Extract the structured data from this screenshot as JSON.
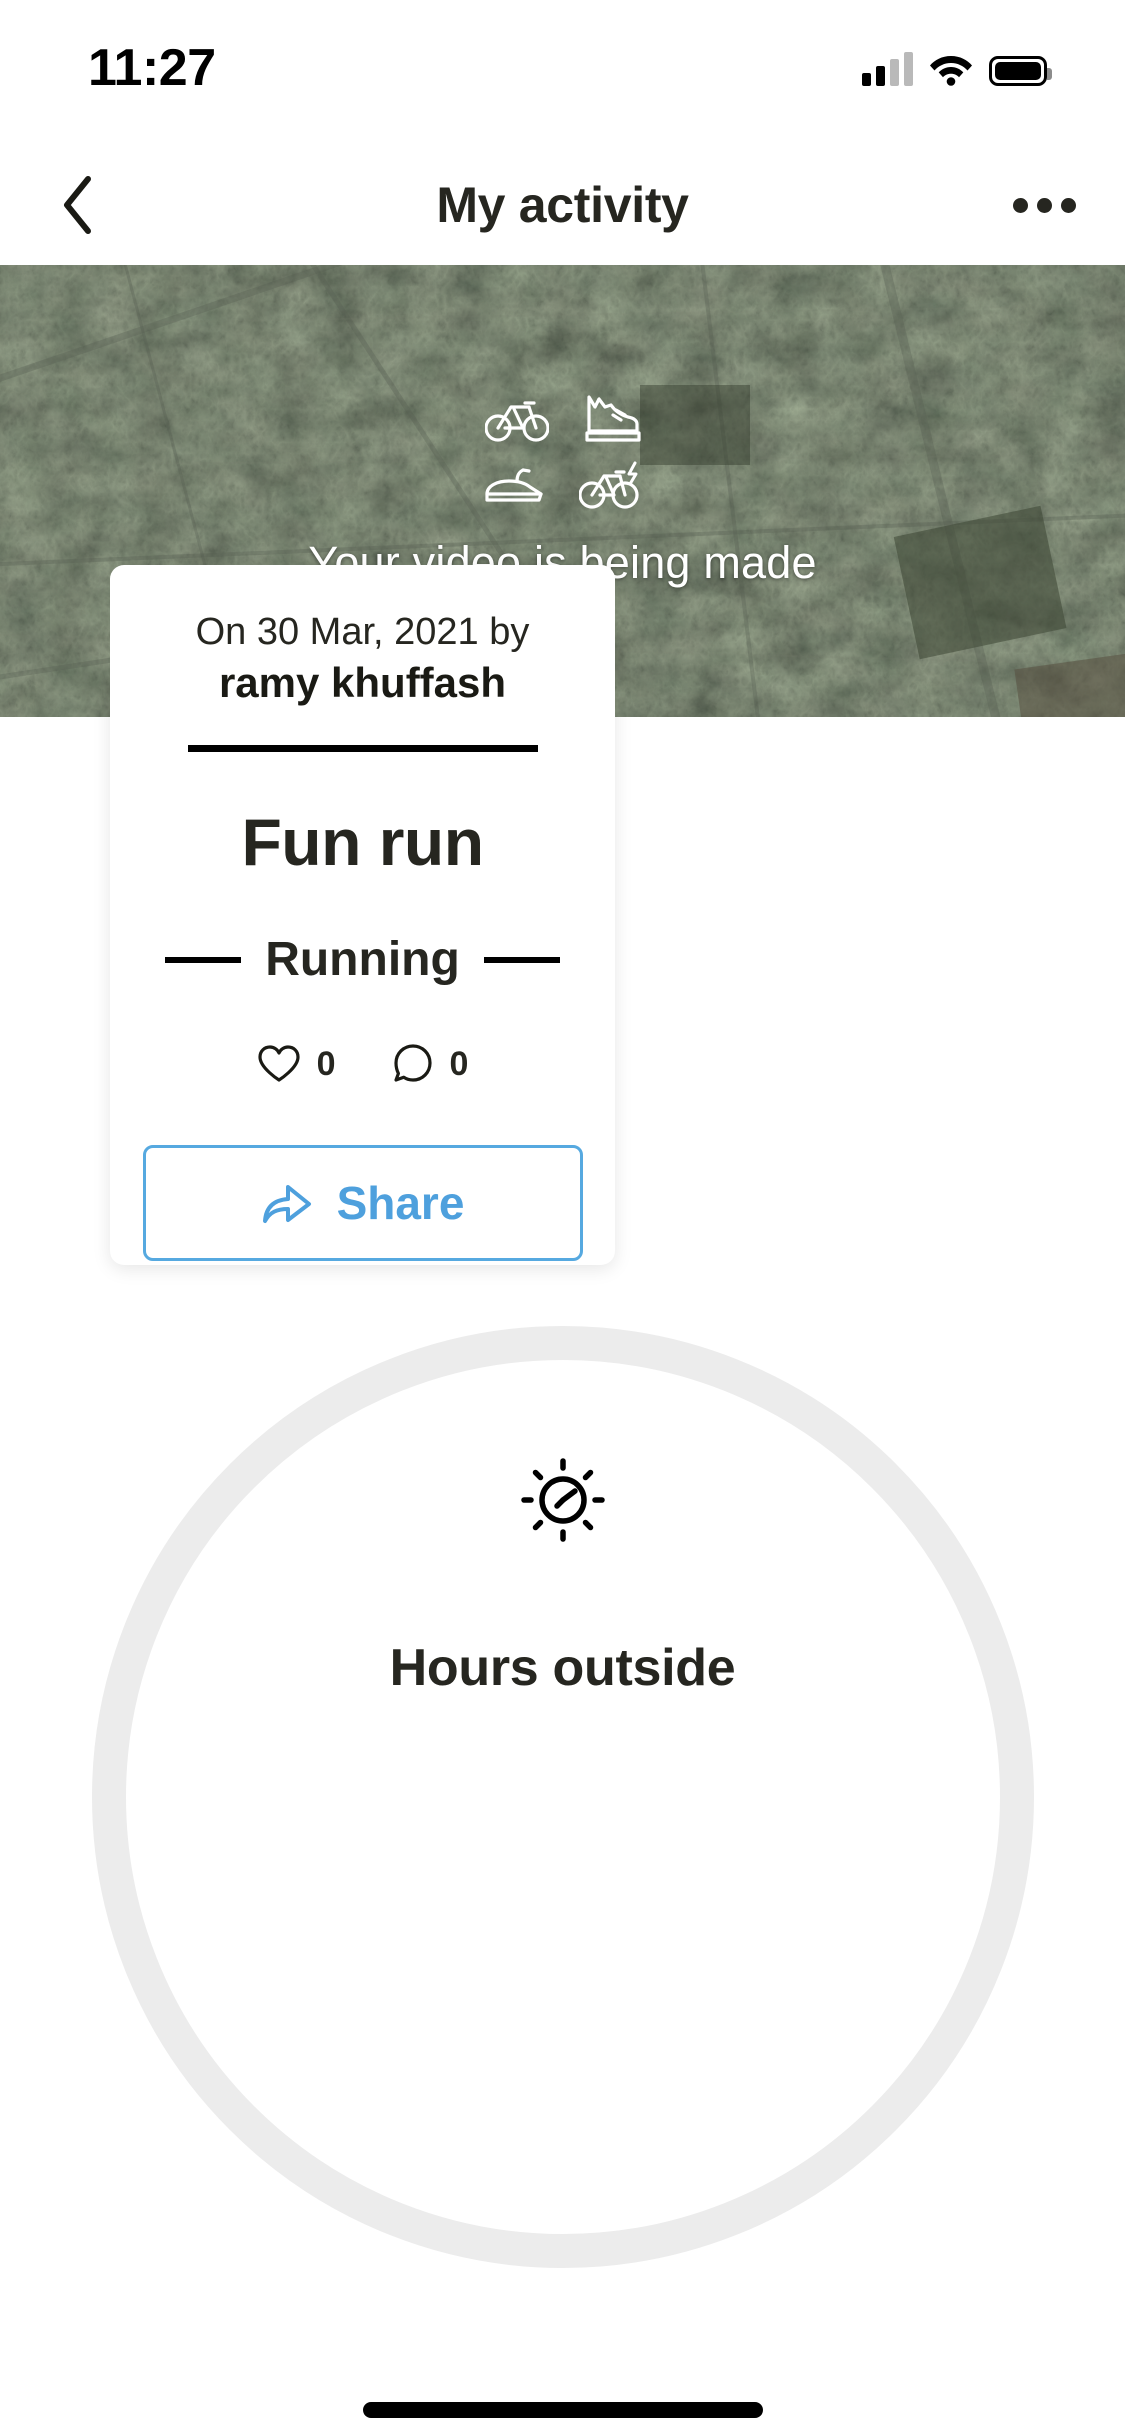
{
  "status_bar": {
    "time": "11:27",
    "icons": [
      "cellular-signal-icon",
      "wifi-icon",
      "battery-icon"
    ]
  },
  "header": {
    "title": "My activity",
    "back_icon": "chevron-left-icon",
    "more_icon": "more-options-icon"
  },
  "map": {
    "type": "satellite-map",
    "video_status_text": "Your video is being made",
    "activity_icons": [
      {
        "name": "bicycle-icon",
        "label": "Cycling"
      },
      {
        "name": "hiking-boot-icon",
        "label": "Walking"
      },
      {
        "name": "jet-ski-icon",
        "label": "Watersport"
      },
      {
        "name": "e-bike-icon",
        "label": "E-biking"
      }
    ]
  },
  "activity_card": {
    "date_line": "On 30 Mar, 2021 by",
    "author": "ramy khuffash",
    "title": "Fun run",
    "activity_type": "Running",
    "likes": {
      "icon": "heart-icon",
      "count": "0"
    },
    "comments": {
      "icon": "comment-bubble-icon",
      "count": "0"
    },
    "share": {
      "icon": "share-arrow-icon",
      "label": "Share",
      "color": "#4ea0dd"
    }
  },
  "bottom_stat": {
    "icon": "sun-clock-icon",
    "label": "Hours outside",
    "ring_track_color": "#ececec"
  }
}
